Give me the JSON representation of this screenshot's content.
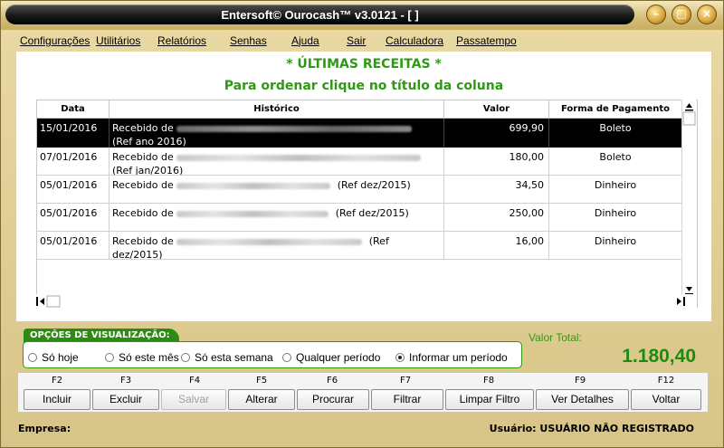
{
  "window": {
    "title": "Entersoft© Ourocash™ v3.0121 - [ ]"
  },
  "menu": [
    "Configurações",
    "Utilitários",
    "Relatórios",
    "Senhas",
    "Ajuda",
    "Sair",
    "Calculadora",
    "Passatempo"
  ],
  "heading": {
    "title": "* ÚLTIMAS RECEITAS *",
    "subtitle": "Para ordenar clique no título da coluna"
  },
  "table": {
    "columns": [
      "Data",
      "Histórico",
      "Valor",
      "Forma de Pagamento"
    ],
    "rows": [
      {
        "data": "15/01/2016",
        "hist_prefix": "Recebido de",
        "hist_ref": "(Ref ano 2016)",
        "valor": "699,90",
        "forma": "Boleto",
        "selected": true
      },
      {
        "data": "07/01/2016",
        "hist_prefix": "Recebido de",
        "hist_ref": "(Ref jan/2016)",
        "valor": "180,00",
        "forma": "Boleto",
        "selected": false
      },
      {
        "data": "05/01/2016",
        "hist_prefix": "Recebido de",
        "hist_ref": "(Ref dez/2015)",
        "valor": "34,50",
        "forma": "Dinheiro",
        "selected": false
      },
      {
        "data": "05/01/2016",
        "hist_prefix": "Recebido de",
        "hist_ref": "(Ref dez/2015)",
        "valor": "250,00",
        "forma": "Dinheiro",
        "selected": false
      },
      {
        "data": "05/01/2016",
        "hist_prefix": "Recebido de",
        "hist_ref": "(Ref dez/2015)",
        "valor": "16,00",
        "forma": "Dinheiro",
        "selected": false
      }
    ]
  },
  "options": {
    "label": "OPÇÕES DE VISUALIZAÇÃO:",
    "radios": [
      "Só hoje",
      "Só este mês",
      "Só esta semana",
      "Qualquer período",
      "Informar um período"
    ],
    "selected_radio": "Informar um período"
  },
  "total": {
    "label": "Valor Total:",
    "value": "1.180,40"
  },
  "buttons": [
    {
      "key": "F2",
      "label": "Incluir",
      "enabled": true
    },
    {
      "key": "F3",
      "label": "Excluir",
      "enabled": true
    },
    {
      "key": "F4",
      "label": "Salvar",
      "enabled": false
    },
    {
      "key": "F5",
      "label": "Alterar",
      "enabled": true
    },
    {
      "key": "F6",
      "label": "Procurar",
      "enabled": true
    },
    {
      "key": "F7",
      "label": "Filtrar",
      "enabled": true
    },
    {
      "key": "F8",
      "label": "Limpar Filtro",
      "enabled": true
    },
    {
      "key": "F9",
      "label": "Ver Detalhes",
      "enabled": true
    },
    {
      "key": "F12",
      "label": "Voltar",
      "enabled": true
    }
  ],
  "status": {
    "empresa_label": "Empresa:",
    "usuario": "Usuário: USUÁRIO NÃO REGISTRADO"
  },
  "colors": {
    "accent_green": "#2e9a14",
    "frame_gold": "#d8c487",
    "title_black": "#000000"
  }
}
